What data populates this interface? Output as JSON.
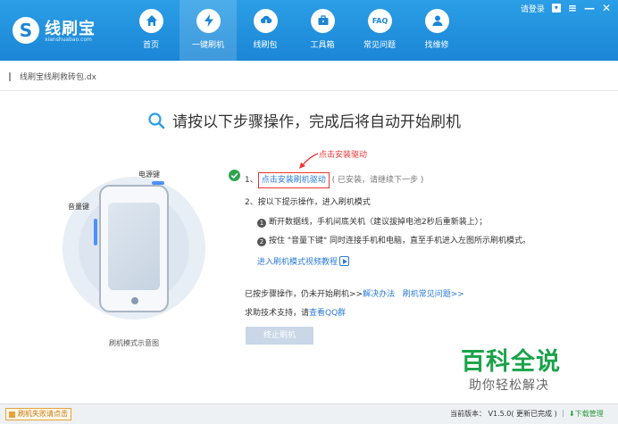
{
  "header": {
    "logo_name": "线刷宝",
    "logo_domain": "xianshuabao.com",
    "nav": [
      {
        "label": "首页",
        "icon": "home-icon"
      },
      {
        "label": "一键刷机",
        "icon": "lightning-icon"
      },
      {
        "label": "线刷包",
        "icon": "cloud-download-icon"
      },
      {
        "label": "工具箱",
        "icon": "toolbox-icon"
      },
      {
        "label": "常见问题",
        "icon": "faq-icon"
      },
      {
        "label": "找维修",
        "icon": "repair-person-icon"
      }
    ],
    "faq_glyph": "FAQ",
    "login": "请登录",
    "active_nav": "一键刷机"
  },
  "file": {
    "name": "线刷宝线刷救砖包.dx"
  },
  "main": {
    "title": "请按以下步骤操作，完成后将自动开始刷机",
    "annotation": "点击安装驱动",
    "step1_prefix": "1、",
    "step1_link": "点击安装刷机驱动",
    "step1_note": "( 已安装，请继续下一步 )",
    "step2": "2、按以下提示操作，进入刷机模式",
    "sub1_num": "1",
    "sub1": "断开数据线，手机间底关机（建议拔掉电池2秒后重新装上）；",
    "sub2_num": "2",
    "sub2": "按住 \"音量下键\" 同时连接手机和电脑，直至手机进入左图所示刷机模式。",
    "tutorial": "进入刷机模式视频教程",
    "help1_prefix": "已按步骤操作，仍未开始刷机>>",
    "help1_link1": "解决办法",
    "help1_link2": "刷机常见问题>>",
    "help2_prefix": "求助技术支持，请",
    "help2_link": "查看QQ群",
    "stop_button": "终止刷机"
  },
  "illustration": {
    "power_label": "电源键",
    "volume_label": "音量键",
    "caption": "刷机模式示意图"
  },
  "watermark": {
    "big": "百科全说",
    "small": "助你轻松解决"
  },
  "status": {
    "feedback": "刷机失败请点击",
    "version": "当前版本： V1.5.0( 更新已完成 ) ｜",
    "download_manager": "下载管理"
  },
  "colors": {
    "header_blue": "#1b86d6",
    "link_blue": "#2b7bd6",
    "annotation_red": "#e33",
    "watermark_green": "#1aa34a"
  }
}
